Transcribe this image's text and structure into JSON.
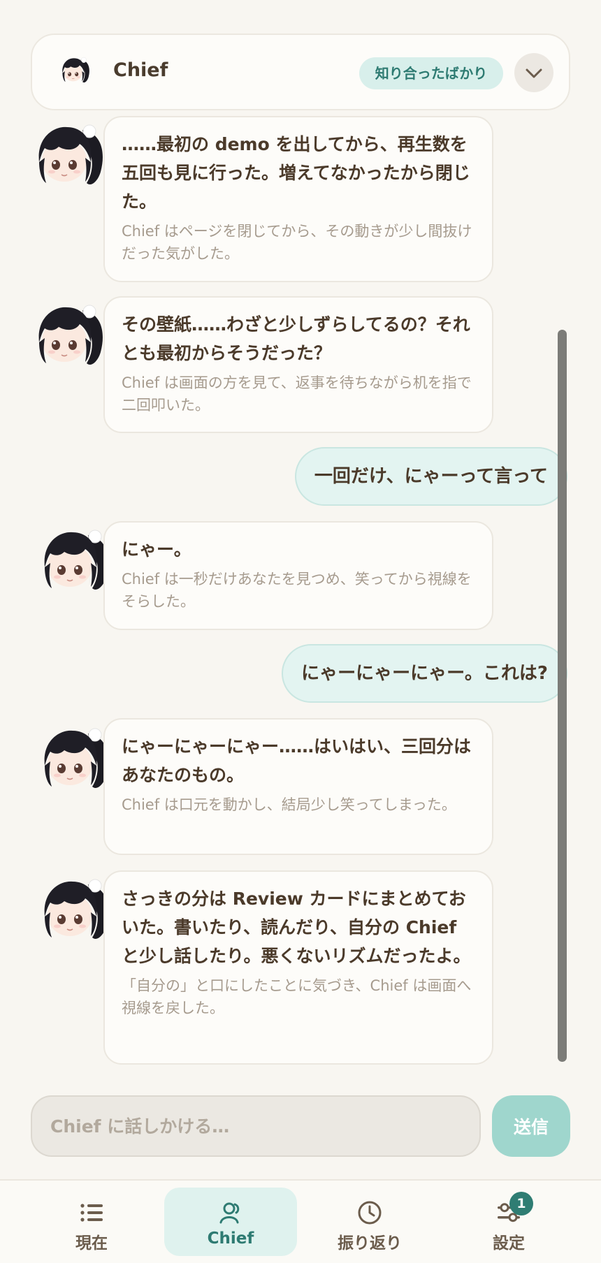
{
  "header": {
    "name": "Chief",
    "status_badge": "知り合ったばかり"
  },
  "messages": [
    {
      "from": "chief",
      "say": "……最初の demo を出してから、再生数を五回も見に行った。増えてなかったから閉じた。",
      "action": "Chief はページを閉じてから、その動きが少し間抜けだった気がした。"
    },
    {
      "from": "chief",
      "say": "その壁紙……わざと少しずらしてるの？それとも最初からそうだった？",
      "action": "Chief は画面の方を見て、返事を待ちながら机を指で二回叩いた。"
    },
    {
      "from": "user",
      "say": "一回だけ、にゃーって言って"
    },
    {
      "from": "chief",
      "say": "にゃー。",
      "action": "Chief は一秒だけあなたを見つめ、笑ってから視線をそらした。"
    },
    {
      "from": "user",
      "say": "にゃーにゃーにゃー。これは?"
    },
    {
      "from": "chief",
      "say": "にゃーにゃーにゃー……はいはい、三回分はあなたのもの。",
      "action": "Chief は口元を動かし、結局少し笑ってしまった。"
    },
    {
      "from": "chief",
      "say": "さっきの分は Review カードにまとめておいた。書いたり、読んだり、自分の Chief と少し話したり。悪くないリズムだったよ。",
      "action": "「自分の」と口にしたことに気づき、Chief は画面へ視線を戻した。"
    }
  ],
  "composer": {
    "placeholder": "Chief に話しかける…",
    "send_label": "送信"
  },
  "nav": {
    "items": [
      {
        "label": "現在",
        "icon": "list-icon"
      },
      {
        "label": "Chief",
        "icon": "person-icon",
        "active": true
      },
      {
        "label": "振り返り",
        "icon": "clock-icon"
      },
      {
        "label": "設定",
        "icon": "sliders-icon",
        "badge": "1"
      }
    ]
  },
  "colors": {
    "accent": "#2e7b72",
    "badge_bg": "#d8efeb",
    "user_bubble": "#e3f4f1",
    "send_button": "#9fd6cd",
    "background": "#f8f6f1"
  }
}
